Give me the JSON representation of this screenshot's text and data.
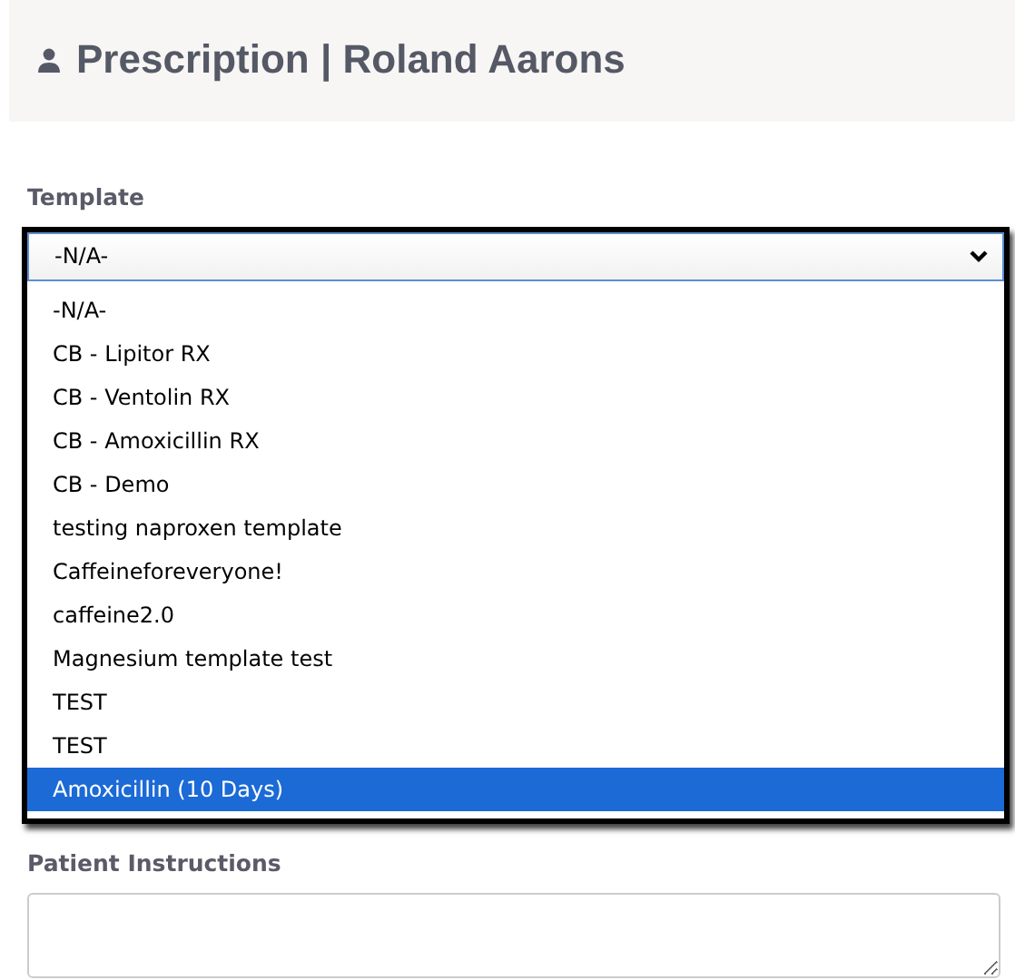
{
  "header": {
    "title": "Prescription | Roland Aarons"
  },
  "template": {
    "label": "Template",
    "value": "-N/A-",
    "options": [
      {
        "label": "-N/A-",
        "highlighted": false
      },
      {
        "label": "CB - Lipitor RX",
        "highlighted": false
      },
      {
        "label": "CB - Ventolin RX",
        "highlighted": false
      },
      {
        "label": "CB - Amoxicillin RX",
        "highlighted": false
      },
      {
        "label": "CB - Demo",
        "highlighted": false
      },
      {
        "label": "testing naproxen template",
        "highlighted": false
      },
      {
        "label": "Caffeineforeveryone!",
        "highlighted": false
      },
      {
        "label": "caffeine2.0",
        "highlighted": false
      },
      {
        "label": "Magnesium template test",
        "highlighted": false
      },
      {
        "label": "TEST",
        "highlighted": false
      },
      {
        "label": "TEST",
        "highlighted": false
      },
      {
        "label": "Amoxicillin (10 Days)",
        "highlighted": true
      }
    ]
  },
  "patient_instructions": {
    "label": "Patient Instructions"
  }
}
